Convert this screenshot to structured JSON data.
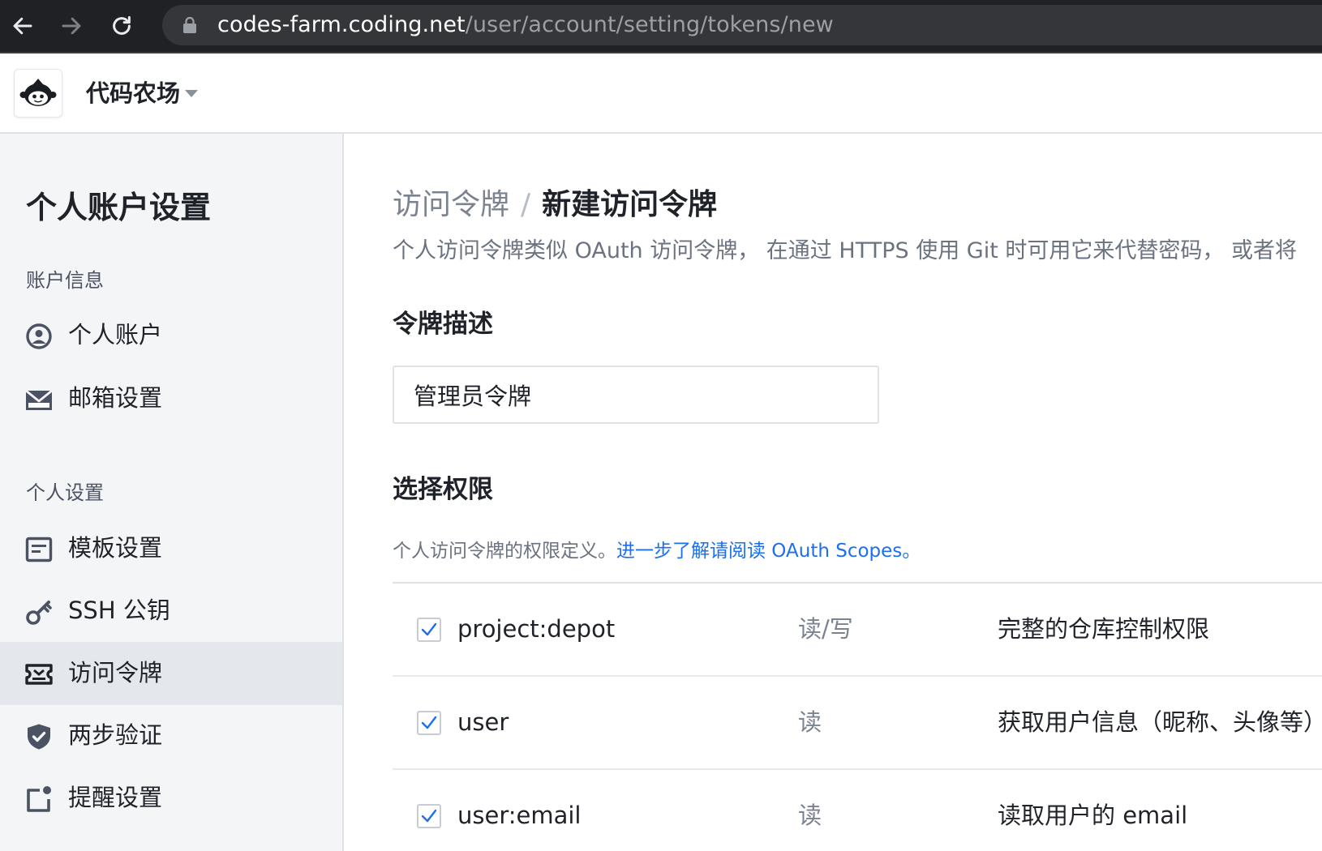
{
  "browser": {
    "url_host": "codes-farm.coding.net",
    "url_path": "/user/account/setting/tokens/new",
    "back_icon": "arrow-left-icon",
    "forward_icon": "arrow-right-icon",
    "reload_icon": "reload-icon",
    "lock_icon": "lock-icon"
  },
  "header": {
    "team_name": "代码农场",
    "logo_icon": "coding-monkey-logo"
  },
  "sidebar": {
    "title": "个人账户设置",
    "groups": [
      {
        "title": "账户信息",
        "items": [
          {
            "label": "个人账户",
            "icon": "user-circle-icon"
          },
          {
            "label": "邮箱设置",
            "icon": "mail-icon"
          }
        ]
      },
      {
        "title": "个人设置",
        "items": [
          {
            "label": "模板设置",
            "icon": "template-icon"
          },
          {
            "label": "SSH 公钥",
            "icon": "key-icon"
          },
          {
            "label": "访问令牌",
            "icon": "ticket-icon",
            "active": true
          },
          {
            "label": "两步验证",
            "icon": "shield-check-icon"
          },
          {
            "label": "提醒设置",
            "icon": "notification-icon"
          }
        ]
      }
    ]
  },
  "main": {
    "breadcrumb": {
      "parent": "访问令牌",
      "separator": "/",
      "current": "新建访问令牌"
    },
    "description": "个人访问令牌类似 OAuth 访问令牌， 在通过 HTTPS 使用 Git 时可用它来代替密码， 或者将",
    "token_desc_label": "令牌描述",
    "token_desc_value": "管理员令牌",
    "scope_label": "选择权限",
    "scope_hint": "个人访问令牌的权限定义。",
    "scope_link": "进一步了解请阅读 OAuth Scopes。",
    "scopes": [
      {
        "name": "project:depot",
        "access": "读/写",
        "desc": "完整的仓库控制权限",
        "checked": true
      },
      {
        "name": "user",
        "access": "读",
        "desc": "获取用户信息（昵称、头像等）",
        "checked": true
      },
      {
        "name": "user:email",
        "access": "读",
        "desc": "读取用户的 email",
        "checked": true
      }
    ]
  },
  "colors": {
    "accent": "#1c6ff0",
    "chrome_bg": "#202124",
    "sidebar_bg": "#f4f5f7",
    "sidebar_active": "#e4e7ec"
  }
}
